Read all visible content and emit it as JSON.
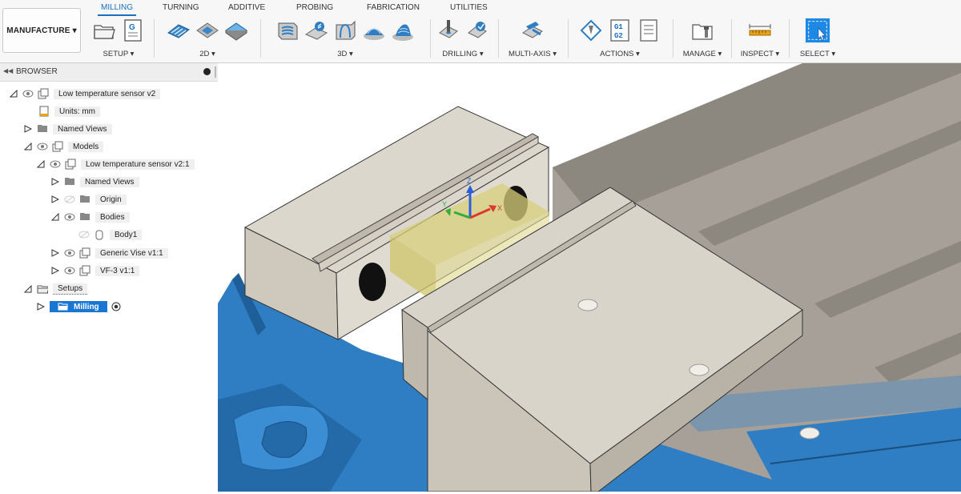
{
  "workspace": {
    "label": "MANUFACTURE ▾"
  },
  "tabs": [
    {
      "label": "MILLING",
      "active": true
    },
    {
      "label": "TURNING"
    },
    {
      "label": "ADDITIVE"
    },
    {
      "label": "PROBING"
    },
    {
      "label": "FABRICATION"
    },
    {
      "label": "UTILITIES"
    }
  ],
  "groups": {
    "setup": "SETUP ▾",
    "2d": "2D ▾",
    "3d": "3D ▾",
    "drilling": "DRILLING ▾",
    "multiaxis": "MULTI-AXIS ▾",
    "actions": "ACTIONS ▾",
    "manage": "MANAGE ▾",
    "inspect": "INSPECT ▾",
    "select": "SELECT ▾"
  },
  "icon_text": {
    "g_code": "G",
    "g1": "G1",
    "g2": "G2"
  },
  "browser": {
    "title": "BROWSER",
    "tree": [
      "Low temperature sensor v2",
      "Units: mm",
      "Named Views",
      "Models",
      "Low temperature sensor v2:1",
      "Named Views",
      "Origin",
      "Bodies",
      "Body1",
      "Generic Vise v1:1",
      "VF-3 v1:1",
      "Setups",
      "Milling"
    ]
  },
  "axes": {
    "z": "Z",
    "x": "X",
    "y": "Y"
  },
  "colors": {
    "accent": "#1a6fc0",
    "selection": "#1976d2",
    "vise_blue": "#2f7ec4",
    "stock": "#d9d4c9",
    "wcs_box": "#d8cf7a"
  }
}
